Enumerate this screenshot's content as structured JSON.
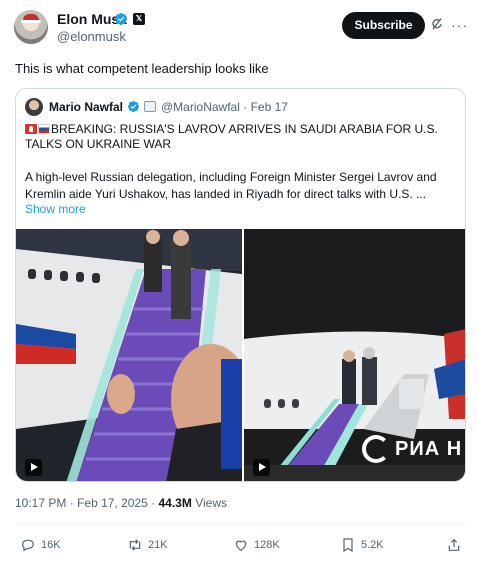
{
  "author": {
    "display_name": "Elon Musk",
    "handle": "@elonmusk",
    "subscribe_label": "Subscribe",
    "verified_color": "#1d9bf0"
  },
  "tweet": {
    "text": "This is what competent leadership looks like"
  },
  "quote": {
    "display_name": "Mario Nawfal",
    "handle": "@MarioNawfal",
    "separator": "·",
    "date": "Feb 17",
    "headline": "BREAKING: RUSSIA'S LAVROV ARRIVES IN SAUDI ARABIA FOR U.S. TALKS ON UKRAINE WAR",
    "body": "A high-level Russian delegation, including Foreign Minister Sergei Lavrov and Kremlin aide Yuri Ushakov, has landed in Riyadh for direct talks with U.S. ...",
    "show_more": "Show more",
    "media": [
      {
        "label": "video-thumbnail-left",
        "overlay_text": ""
      },
      {
        "label": "video-thumbnail-right",
        "overlay_text": "РИА Н"
      }
    ]
  },
  "meta": {
    "time": "10:17 PM",
    "separator": "·",
    "date": "Feb 17, 2025",
    "views_count": "44.3M",
    "views_label": "Views"
  },
  "actions": {
    "replies": "16K",
    "reposts": "21K",
    "likes": "128K",
    "bookmarks": "5.2K"
  },
  "colors": {
    "accent": "#1d9bf0",
    "text": "#0f1419",
    "muted": "#536471",
    "border": "#cfd9de",
    "stairs": "#6a4bb8"
  }
}
